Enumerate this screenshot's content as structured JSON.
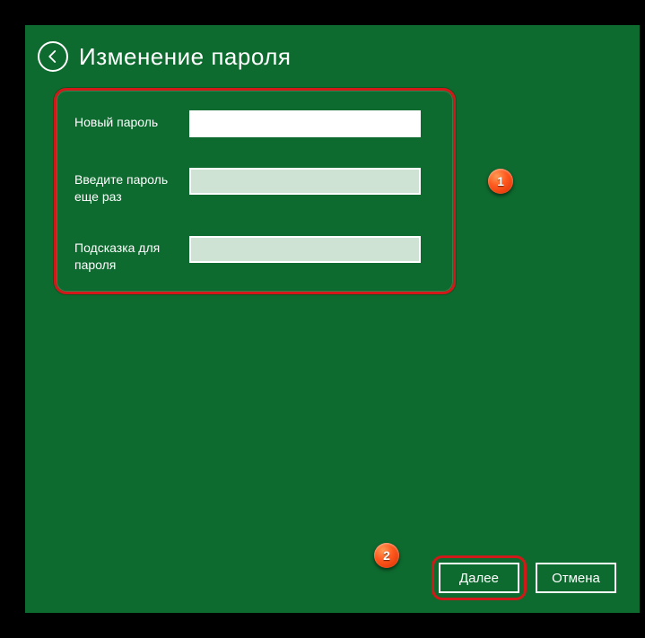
{
  "title": "Изменение пароля",
  "form": {
    "newPassword": {
      "label": "Новый пароль",
      "value": ""
    },
    "confirmPassword": {
      "label": "Введите пароль еще раз",
      "value": ""
    },
    "hint": {
      "label": "Подсказка для пароля",
      "value": ""
    }
  },
  "buttons": {
    "next": "Далее",
    "cancel": "Отмена"
  },
  "markers": {
    "one": "1",
    "two": "2"
  }
}
